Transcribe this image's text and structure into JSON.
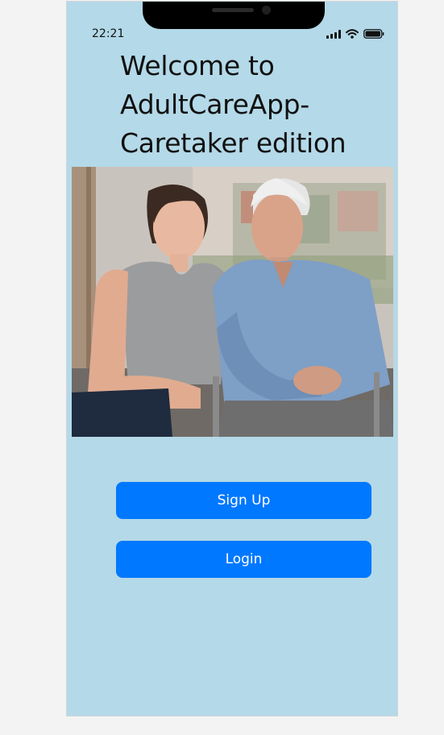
{
  "status_bar": {
    "time": "22:21",
    "icons": [
      "signal-icon",
      "wifi-icon",
      "battery-icon"
    ]
  },
  "welcome": {
    "title": "Welcome to AdultCareApp-Caretaker edition"
  },
  "hero_image": {
    "description": "smiling young woman caretaker seated beside elderly man in wheelchair"
  },
  "actions": {
    "signup_label": "Sign Up",
    "login_label": "Login"
  },
  "colors": {
    "screen_background": "#b4d9e8",
    "button_primary": "#0078ff",
    "button_text": "#ffffff"
  }
}
